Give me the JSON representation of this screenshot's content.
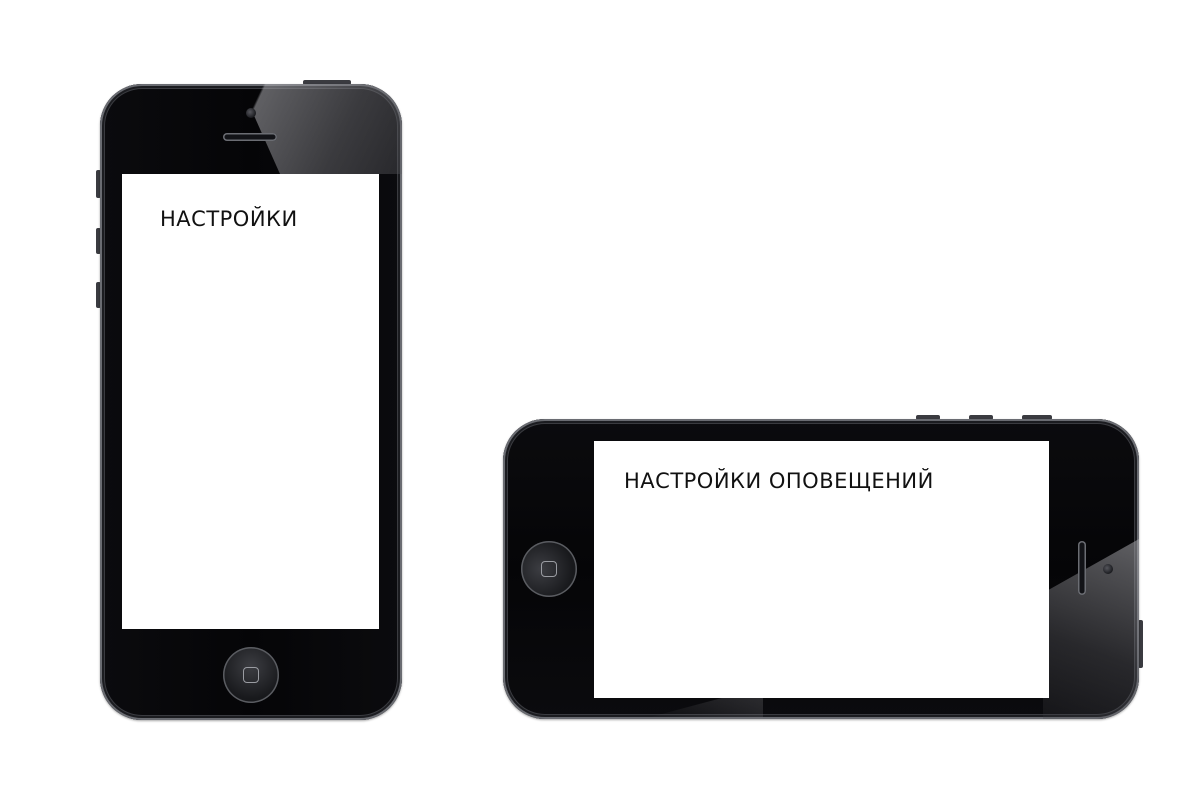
{
  "portrait_phone": {
    "screen_title": "НАСТРОЙКИ"
  },
  "landscape_phone": {
    "screen_title": "НАСТРОЙКИ ОПОВЕЩЕНИЙ"
  },
  "colors": {
    "phone_body": "#050507",
    "screen_background": "#ffffff",
    "text": "#111111"
  },
  "icons": [
    "home-button-icon",
    "camera-icon",
    "speaker-icon"
  ]
}
